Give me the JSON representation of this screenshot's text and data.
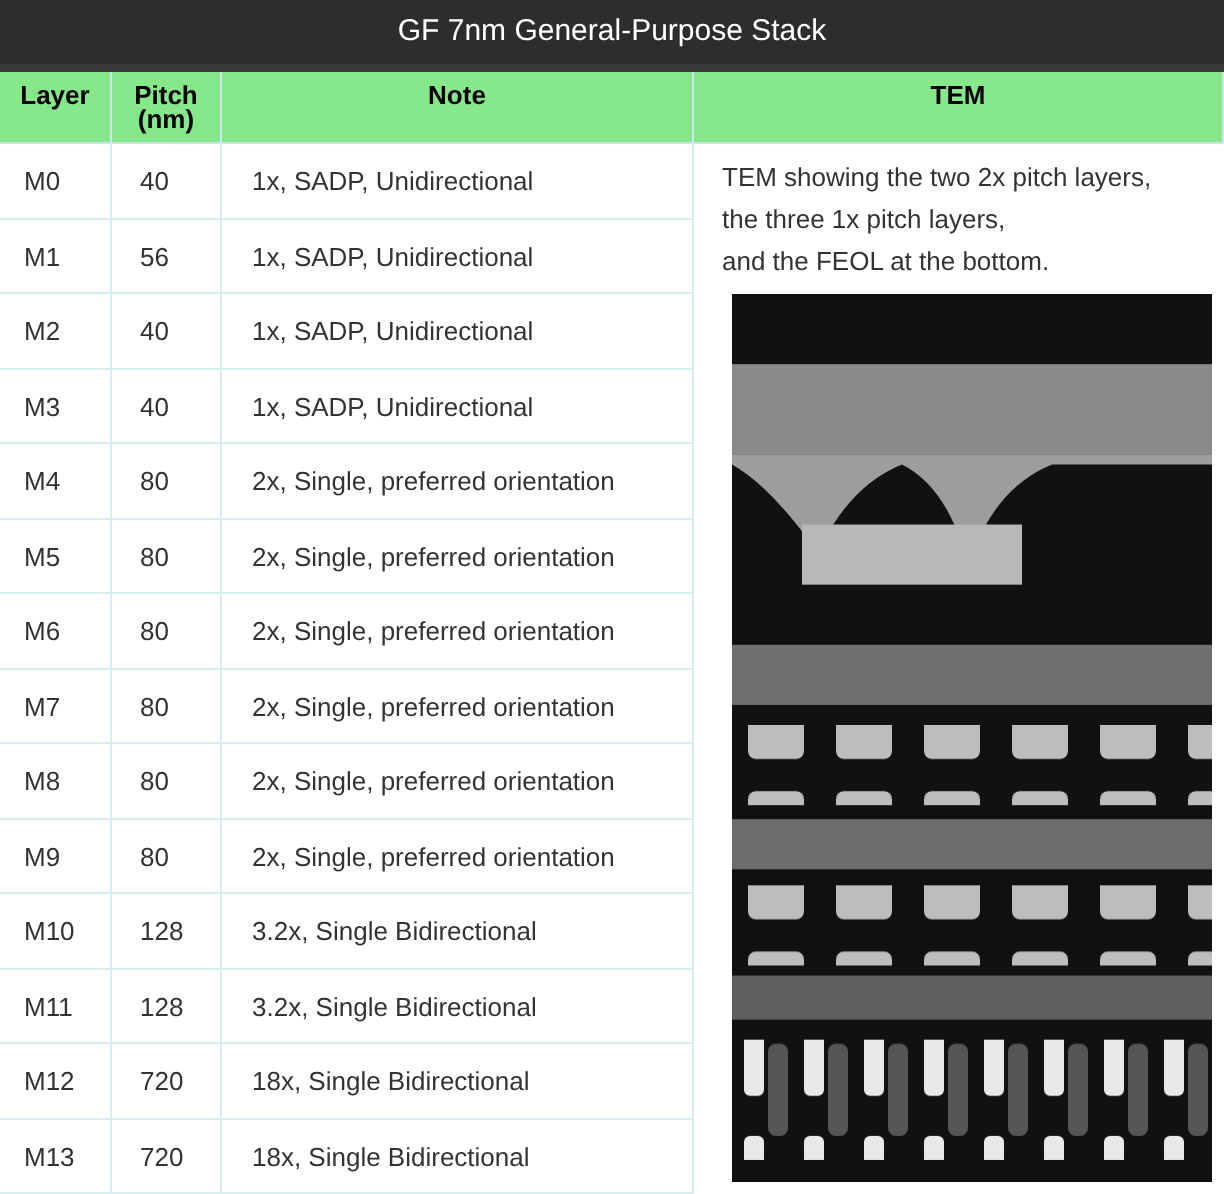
{
  "title": "GF 7nm General-Purpose Stack",
  "columns": [
    "Layer",
    "Pitch\n(nm)",
    "Note",
    "TEM"
  ],
  "rows": [
    {
      "layer": "M0",
      "pitch": "40",
      "note": "1x, SADP, Unidirectional"
    },
    {
      "layer": "M1",
      "pitch": "56",
      "note": "1x, SADP, Unidirectional"
    },
    {
      "layer": "M2",
      "pitch": "40",
      "note": "1x, SADP, Unidirectional"
    },
    {
      "layer": "M3",
      "pitch": "40",
      "note": "1x, SADP, Unidirectional"
    },
    {
      "layer": "M4",
      "pitch": "80",
      "note": "2x, Single, preferred orientation"
    },
    {
      "layer": "M5",
      "pitch": "80",
      "note": "2x, Single, preferred orientation"
    },
    {
      "layer": "M6",
      "pitch": "80",
      "note": "2x, Single, preferred orientation"
    },
    {
      "layer": "M7",
      "pitch": "80",
      "note": "2x, Single, preferred orientation"
    },
    {
      "layer": "M8",
      "pitch": "80",
      "note": "2x, Single, preferred orientation"
    },
    {
      "layer": "M9",
      "pitch": "80",
      "note": "2x, Single, preferred orientation"
    },
    {
      "layer": "M10",
      "pitch": "128",
      "note": "3.2x, Single Bidirectional"
    },
    {
      "layer": "M11",
      "pitch": "128",
      "note": "3.2x, Single Bidirectional"
    },
    {
      "layer": "M12",
      "pitch": "720",
      "note": "18x, Single Bidirectional"
    },
    {
      "layer": "M13",
      "pitch": "720",
      "note": "18x, Single Bidirectional"
    }
  ],
  "tem": {
    "caption": [
      "TEM showing the two 2x pitch layers,",
      "the three 1x pitch layers,",
      "and the FEOL at the bottom."
    ],
    "image": {
      "kind": "picture"
    }
  }
}
